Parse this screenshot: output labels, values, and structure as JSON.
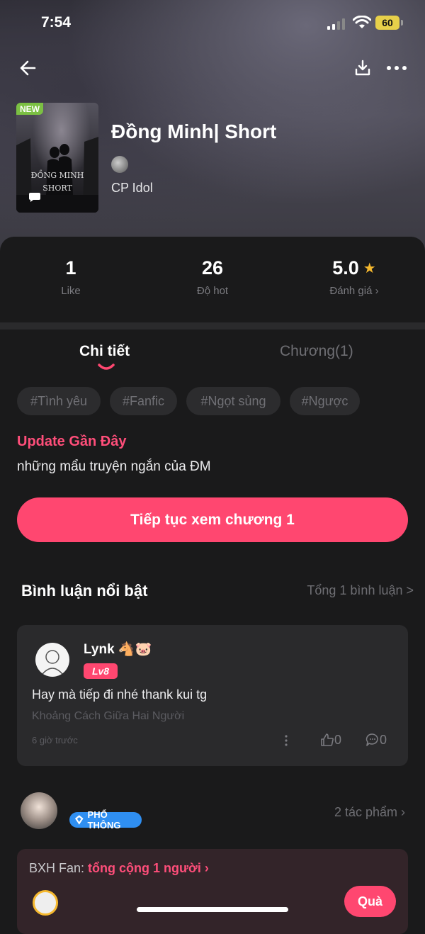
{
  "status_bar": {
    "time": "7:54",
    "battery": "60"
  },
  "book": {
    "badge": "NEW",
    "cover_text_1": "ĐỒNG MINH",
    "cover_text_2": "SHORT",
    "title": "Đồng Minh| Short",
    "author": "CP Idol"
  },
  "stats": [
    {
      "value": "1",
      "label": "Like"
    },
    {
      "value": "26",
      "label": "Độ hot"
    },
    {
      "value": "5.0",
      "label": "Đánh giá ›"
    }
  ],
  "tabs": {
    "details": "Chi tiết",
    "chapters": "Chương(1)"
  },
  "tags": [
    "#Tình yêu",
    "#Fanfic",
    "#Ngọt sủng",
    "#Ngược"
  ],
  "update": {
    "title": "Update Gần Đây",
    "description": "những mẩu truyện ngắn của ĐM"
  },
  "cta_label": "Tiếp tục xem chương 1",
  "comments_section": {
    "title": "Bình luận nổi bật",
    "total_link": "Tổng 1 bình luận >"
  },
  "comment": {
    "username": "Lynk 🐴🐷",
    "level": "Lv8",
    "text": "Hay mà tiếp đi nhé thank kui tg",
    "source": "Khoảng Cách Giữa Hai Người",
    "time": "6 giờ trước",
    "likes": "0",
    "replies": "0"
  },
  "author_row": {
    "badge": "PHỔ THÔNG",
    "works_link": "2 tác phẩm ›"
  },
  "fan_ranking": {
    "prefix": "BXH Fan: ",
    "highlight": "tổng cộng 1 người ›",
    "gift_button": "Quà"
  },
  "colors": {
    "accent": "#ff4770",
    "star": "#f5b82e",
    "new_badge": "#7bc043",
    "badge_blue": "#2f8ff2"
  }
}
